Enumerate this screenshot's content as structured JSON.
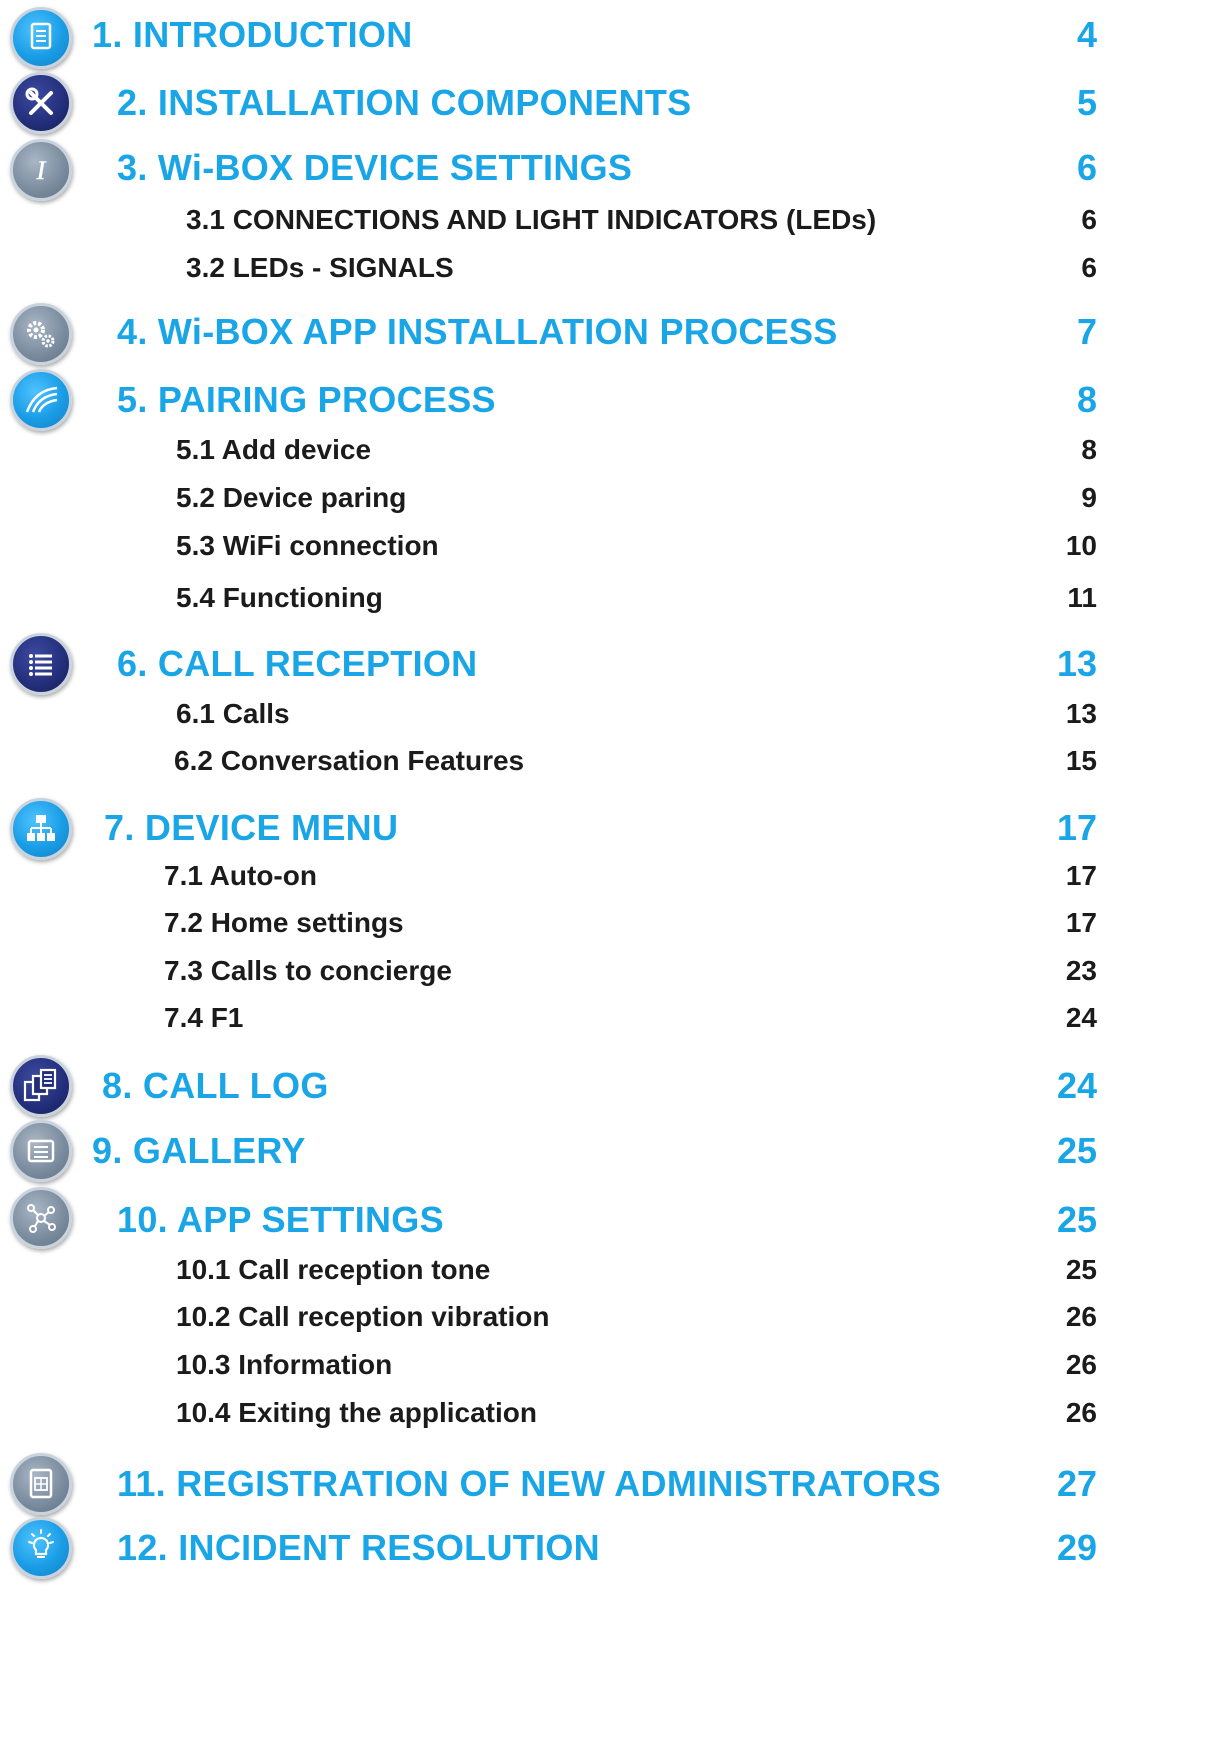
{
  "toc": {
    "s1": {
      "title": "1. INTRODUCTION",
      "page": "4",
      "icon": "document-icon"
    },
    "s2": {
      "title": "2. INSTALLATION COMPONENTS",
      "page": "5",
      "icon": "tools-icon"
    },
    "s3": {
      "title": "3. Wi-BOX DEVICE SETTINGS",
      "page": "6",
      "icon": "italic-i-icon",
      "sub": [
        {
          "title": "3.1 CONNECTIONS AND LIGHT INDICATORS (LEDs)",
          "page": "6"
        },
        {
          "title": "3.2 LEDs - SIGNALS",
          "page": "6"
        }
      ]
    },
    "s4": {
      "title": "4. Wi-BOX APP INSTALLATION PROCESS",
      "page": "7",
      "icon": "gears-icon"
    },
    "s5": {
      "title": "5. PAIRING PROCESS",
      "page": "8",
      "icon": "signal-icon",
      "sub": [
        {
          "title": "5.1 Add device",
          "page": "8"
        },
        {
          "title": "5.2 Device paring",
          "page": "9"
        },
        {
          "title": "5.3 WiFi connection",
          "page": "10"
        },
        {
          "title": "5.4 Functioning",
          "page": "11"
        }
      ]
    },
    "s6": {
      "title": "6. CALL RECEPTION",
      "page": "13",
      "icon": "list-icon",
      "sub": [
        {
          "title": "6.1 Calls",
          "page": "13"
        },
        {
          "title": "6.2 Conversation Features",
          "page": "15"
        }
      ]
    },
    "s7": {
      "title": "7. DEVICE MENU",
      "page": "17",
      "icon": "hierarchy-icon",
      "sub": [
        {
          "title": "7.1 Auto-on",
          "page": "17"
        },
        {
          "title": "7.2 Home settings",
          "page": "17"
        },
        {
          "title": "7.3 Calls to concierge",
          "page": "23"
        },
        {
          "title": "7.4 F1",
          "page": "24"
        }
      ]
    },
    "s8": {
      "title": "8. CALL LOG",
      "page": "24",
      "icon": "documents-icon"
    },
    "s9": {
      "title": "9. GALLERY",
      "page": "25",
      "icon": "gallery-icon"
    },
    "s10": {
      "title": "10. APP SETTINGS",
      "page": "25",
      "icon": "network-icon",
      "sub": [
        {
          "title": "10.1 Call reception tone",
          "page": "25"
        },
        {
          "title": "10.2 Call reception vibration",
          "page": "26"
        },
        {
          "title": "10.3 Information",
          "page": "26"
        },
        {
          "title": "10.4 Exiting the application",
          "page": "26"
        }
      ]
    },
    "s11": {
      "title": "11. REGISTRATION OF NEW ADMINISTRATORS",
      "page": "27",
      "icon": "form-icon"
    },
    "s12": {
      "title": "12. INCIDENT RESOLUTION",
      "page": "29",
      "icon": "lightbulb-icon"
    }
  },
  "colors": {
    "heading": "#1aa6e6",
    "subheading": "#1b1b1b",
    "icon_blue": "#1a9de6",
    "icon_navy": "#232e7a",
    "icon_gray": "#7d8ea1"
  }
}
